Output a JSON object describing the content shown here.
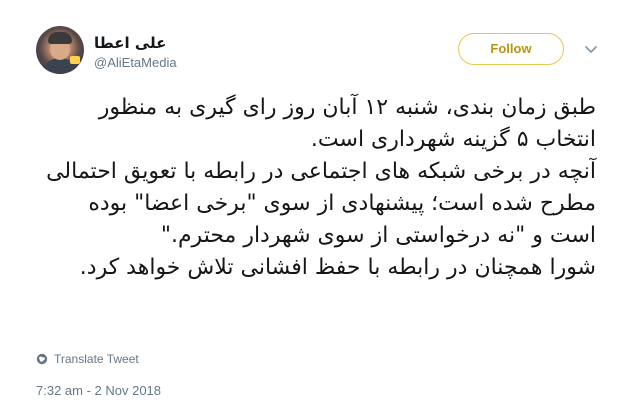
{
  "tweet": {
    "author": {
      "display_name": "علی اعطا",
      "handle": "@AliEtaMedia"
    },
    "follow_label": "Follow",
    "paragraphs": [
      "طبق زمان بندی، شنبه ۱۲ آبان روز رای گیری به منظور انتخاب ۵ گزینه شهرداری است.",
      "آنچه در برخی شبکه های اجتماعی در رابطه با تعویق احتمالی مطرح شده است؛ پیشنهادی از سوی \"برخی اعضا\" بوده است و \"نه درخواستی از سوی شهردار محترم.\"",
      "شورا همچنان در رابطه با حفظ افشانی تلاش خواهد کرد."
    ],
    "translate_label": "Translate Tweet",
    "timestamp": "7:32 am - 2 Nov 2018"
  },
  "icons": {
    "menu": "chevron-down-icon",
    "translate": "globe-icon"
  },
  "colors": {
    "follow_border": "#e8c850",
    "follow_text": "#b8960f",
    "secondary_text": "#657786",
    "primary_text": "#14171a"
  }
}
